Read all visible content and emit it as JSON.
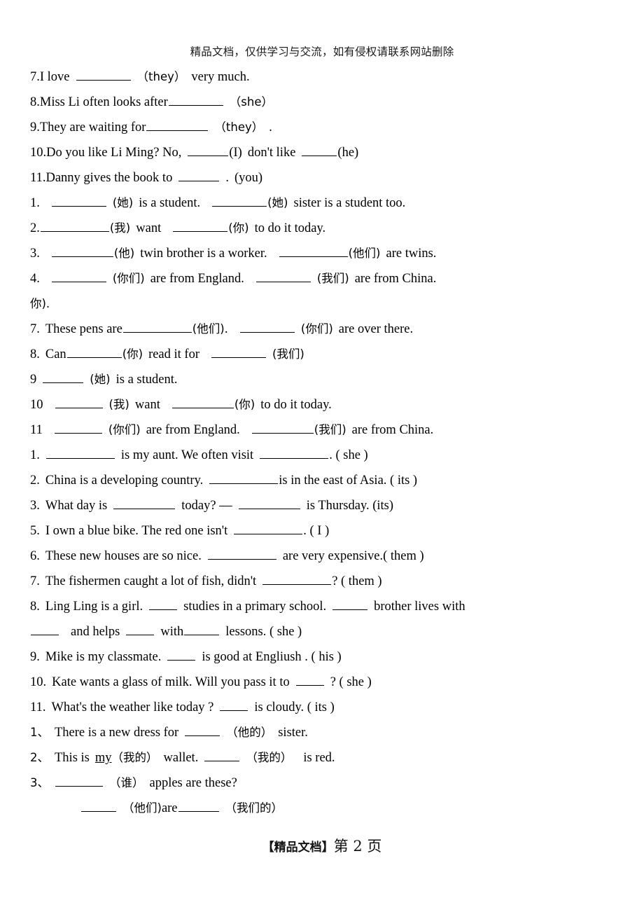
{
  "document": {
    "header_note": "精品文档，仅供学习与交流，如有侵权请联系网站删除",
    "footer_mark": "【精品文档】",
    "footer_page": "第 2 页"
  },
  "questions": [
    {
      "id": "q7a",
      "num": "7.",
      "text_before": "I love",
      "cue": "（they）",
      "text_after": "very much."
    },
    {
      "id": "q8a",
      "num": "8.",
      "text_before": "Miss Li often looks after",
      "cue": "（she）",
      "text_after": ""
    },
    {
      "id": "q9a",
      "num": "9.",
      "text_before": "They are waiting for",
      "cue": "（they）",
      "text_after": "."
    },
    {
      "id": "q10a",
      "num": "10.",
      "text_before": "Do you like Li Ming? No,",
      "cue": "(I)",
      "text_after": "don't like",
      "cue2": "(he)"
    },
    {
      "id": "q11a",
      "num": "11.",
      "text_before": "Danny gives the book to",
      "cue": "(you)",
      "text_after": "."
    },
    {
      "id": "q1b",
      "num": "1.",
      "cue1": "(她)",
      "t1": "is a student.",
      "cue2": "(她)",
      "t2": "sister is a student too."
    },
    {
      "id": "q2b",
      "num": "2.",
      "cue1": "(我)",
      "t1": "want",
      "cue2": "(你)",
      "t2": "to do it today."
    },
    {
      "id": "q3b",
      "num": "3.",
      "cue1": "(他)",
      "t1": "twin brother is a worker.",
      "cue2": "(他们)",
      "t2": "are twins."
    },
    {
      "id": "q4b",
      "num": "4.",
      "cue1": "(你们)",
      "t1": "are from England.",
      "cue2": "(我们)",
      "t2": "are from China."
    },
    {
      "id": "orphan",
      "text": "你)."
    },
    {
      "id": "q7b",
      "num": "7.",
      "t0": "These pens are",
      "cue1": "(他们).",
      "cue2": "(你们)",
      "t2": "are over there."
    },
    {
      "id": "q8b",
      "num": "8.",
      "t0": "Can",
      "cue1": "(你)",
      "t1": "read it for",
      "cue2": "(我们)"
    },
    {
      "id": "q9b",
      "num": "9",
      "cue1": "(她)",
      "t1": "is a student."
    },
    {
      "id": "q10b",
      "num": "10",
      "cue1": "(我)",
      "t1": "want",
      "cue2": "(你)",
      "t2": "to do it today."
    },
    {
      "id": "q11b",
      "num": "11",
      "cue1": "(你们)",
      "t1": "are from England.",
      "cue2": "(我们)",
      "t2": "are from China."
    },
    {
      "id": "q1c",
      "num": "1.",
      "t1": "is my aunt. We often visit",
      "t2": ". ( she )"
    },
    {
      "id": "q2c",
      "num": "2.",
      "t0": "China is a developing country.",
      "t2": "is in the east of Asia. ( its )"
    },
    {
      "id": "q3c",
      "num": "3.",
      "t0": "What day is",
      "t1": "today?   —",
      "t2": "is Thursday. (its)"
    },
    {
      "id": "q5c",
      "num": "5.",
      "t0": "I own a blue bike. The red one isn't",
      "t2": ". ( I )"
    },
    {
      "id": "q6c",
      "num": "6.",
      "t0": "These new houses are so nice.",
      "t2": "are very expensive.( them )"
    },
    {
      "id": "q7c",
      "num": "7.",
      "t0": "The fishermen caught a lot of fish, didn't",
      "t2": "? ( them )"
    },
    {
      "id": "q8c",
      "num": "8.",
      "t0": "Ling Ling is a girl.",
      "t1": "studies in a primary school.",
      "t2": "brother lives with"
    },
    {
      "id": "q8c2",
      "t0": "and helps",
      "t1": "with",
      "t2": "lessons. ( she )"
    },
    {
      "id": "q9c",
      "num": "9.",
      "t0": "Mike is my classmate.",
      "t2": "is good at Engliush . ( his )"
    },
    {
      "id": "q10c",
      "num": "10.",
      "t0": "Kate wants a glass of milk. Will you pass it to",
      "t2": "? ( she )"
    },
    {
      "id": "q11c",
      "num": "11.",
      "t0": "What's the weather like today ?",
      "t2": "is cloudy. ( its )"
    },
    {
      "id": "q1d",
      "num": "1、",
      "t0": "There is a new dress for",
      "cue1": "（他的）",
      "t2": "sister."
    },
    {
      "id": "q2d",
      "num": "2、",
      "t0": "This is",
      "underlined": "my",
      "cue1": "（我的）",
      "t1": "wallet.",
      "cue2": "（我的）",
      "t2": "is red."
    },
    {
      "id": "q3d",
      "num": "3、",
      "cue1": "（谁）",
      "t1": "apples are these?"
    },
    {
      "id": "q3d2",
      "cue1": "（他们)",
      "t1": "are",
      "cue2": "（我们的）"
    }
  ]
}
